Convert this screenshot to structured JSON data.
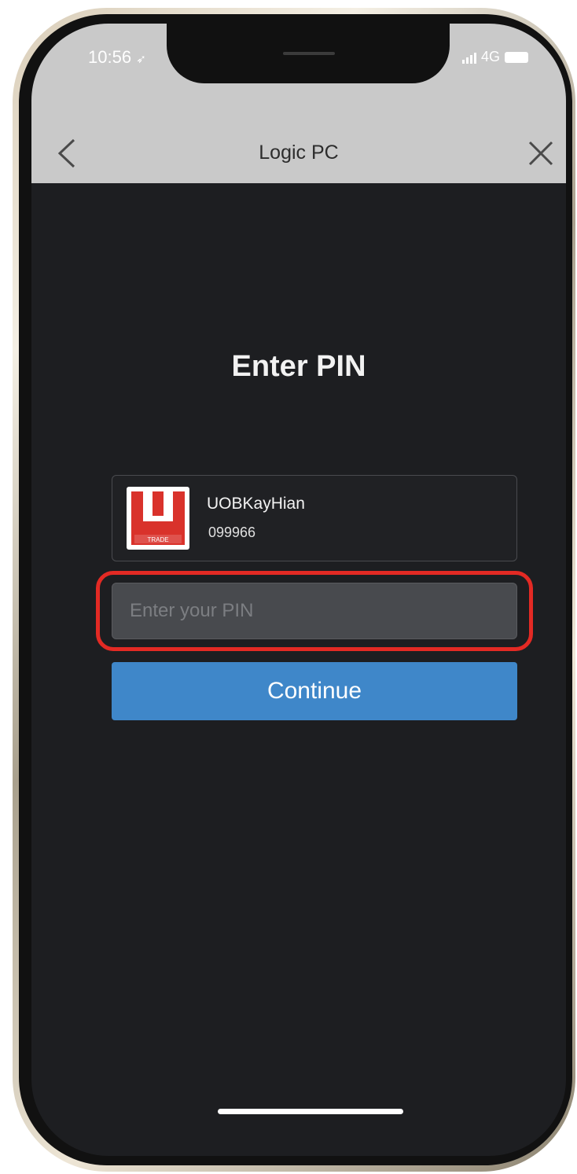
{
  "status_bar": {
    "time": "10:56",
    "network": "4G",
    "icons": [
      "location-arrow-icon",
      "signal-bars-icon",
      "battery-icon"
    ]
  },
  "nav": {
    "title": "Logic PC",
    "back_icon": "chevron-left-icon",
    "close_icon": "close-icon"
  },
  "page": {
    "title": "Enter PIN"
  },
  "account": {
    "broker_name": "UOBKayHian",
    "account_id": "099966",
    "logo_text": "TRADE",
    "logo_letter": "U",
    "logo_color": "#d9322b"
  },
  "pin_field": {
    "placeholder": "Enter your PIN",
    "value": "",
    "highlight_color": "#e32a24"
  },
  "continue_button": {
    "label": "Continue",
    "color": "#3f87c9"
  }
}
